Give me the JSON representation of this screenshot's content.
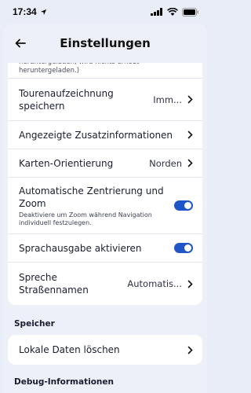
{
  "status": {
    "time": "17:34"
  },
  "header": {
    "title": "Einstellungen",
    "back_icon": "arrow-left-icon"
  },
  "card1": {
    "truncated_note": "heruntergeladen, wird nichts erneut heruntergeladen.)",
    "rows": [
      {
        "label": "Tourenaufzeichnung speichern",
        "value": "Imm..."
      },
      {
        "label": "Angezeigte Zusatzinformationen"
      },
      {
        "label": "Karten-Orientierung",
        "value": "Norden"
      },
      {
        "label": "Automatische Zentrierung und Zoom",
        "sub": "Deaktiviere um Zoom während Navigation individuell festzulegen.",
        "toggle": true
      },
      {
        "label": "Sprachausgabe aktivieren",
        "toggle": true
      },
      {
        "label": "Spreche Straßennamen",
        "value": "Automatis..."
      }
    ]
  },
  "storage": {
    "title": "Speicher",
    "rows": [
      {
        "label": "Lokale Daten löschen"
      }
    ]
  },
  "debug": {
    "title": "Debug-Informationen"
  },
  "colors": {
    "accent": "#1f55c7",
    "background": "#edf0f8"
  }
}
